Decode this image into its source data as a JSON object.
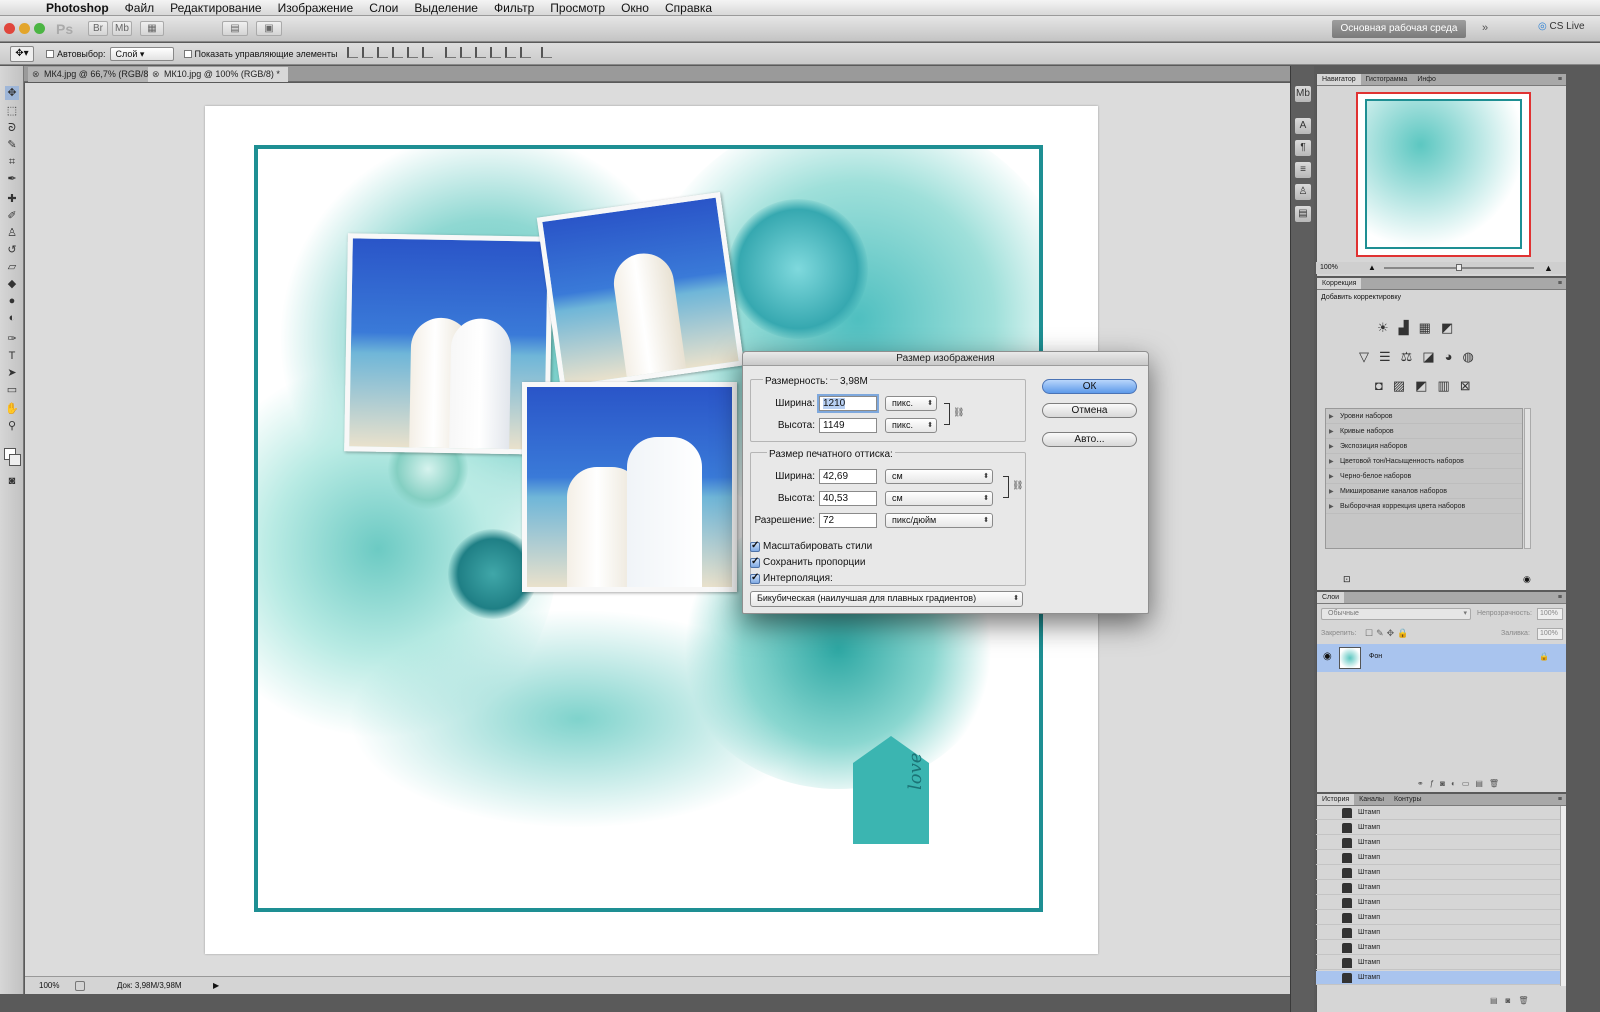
{
  "menubar": {
    "app": "Photoshop",
    "items": [
      "Файл",
      "Редактирование",
      "Изображение",
      "Слои",
      "Выделение",
      "Фильтр",
      "Просмотр",
      "Окно",
      "Справка"
    ]
  },
  "appbar": {
    "ps_label": "Ps",
    "workspace": "Основная рабочая среда",
    "cs_live": "CS Live"
  },
  "options": {
    "autoselect": "Автовыбор:",
    "layer_select": "Слой",
    "show_controls": "Показать управляющие элементы"
  },
  "tabs": [
    {
      "label": "МК4.jpg @ 66,7% (RGB/8)",
      "active": false
    },
    {
      "label": "МК10.jpg @ 100% (RGB/8) *",
      "active": true
    }
  ],
  "status": {
    "zoom": "100%",
    "doc": "Док: 3,98M/3,98M"
  },
  "panels": {
    "navigator": {
      "tabs": [
        "Навигатор",
        "Гистограмма",
        "Инфо"
      ],
      "zoom": "100%"
    },
    "correction": {
      "tab": "Коррекция",
      "subtitle": "Добавить корректировку",
      "presets": [
        "Уровни наборов",
        "Кривые наборов",
        "Экспозиция наборов",
        "Цветовой тон/Насыщенность наборов",
        "Черно-белое наборов",
        "Микширование каналов наборов",
        "Выборочная коррекция цвета наборов"
      ]
    },
    "layers": {
      "tab": "Слои",
      "blend": "Обычные",
      "opacity_label": "Непрозрачность:",
      "opacity": "100%",
      "lock_label": "Закрепить:",
      "fill_label": "Заливка:",
      "fill": "100%",
      "layer_name": "Фон"
    },
    "history": {
      "tabs": [
        "История",
        "Каналы",
        "Контуры"
      ],
      "items": [
        "Штамп",
        "Штамп",
        "Штамп",
        "Штамп",
        "Штамп",
        "Штамп",
        "Штамп",
        "Штамп",
        "Штамп",
        "Штамп",
        "Штамп",
        "Штамп"
      ]
    }
  },
  "dialog": {
    "title": "Размер изображения",
    "pixel_dims_label": "Размерность:",
    "pixel_dims_value": "3,98M",
    "width_label": "Ширина:",
    "width_px": "1210",
    "height_label": "Высота:",
    "height_px": "1149",
    "px_unit": "пикс.",
    "print_group": "Размер печатного оттиска:",
    "print_width": "42,69",
    "print_height": "40,53",
    "cm_unit": "см",
    "resolution_label": "Разрешение:",
    "resolution": "72",
    "res_unit": "пикс/дюйм",
    "cb_scale": "Масштабировать стили",
    "cb_constrain": "Сохранить пропорции",
    "cb_resample": "Интерполяция:",
    "resample_method": "Бикубическая (наилучшая для плавных градиентов)",
    "ok": "ОК",
    "cancel": "Отмена",
    "auto": "Авто..."
  },
  "artwork": {
    "love": "love"
  },
  "colors": {
    "accent": "#1e8f93",
    "teal": "#3bb5b1",
    "sky": "#2a55c8"
  }
}
